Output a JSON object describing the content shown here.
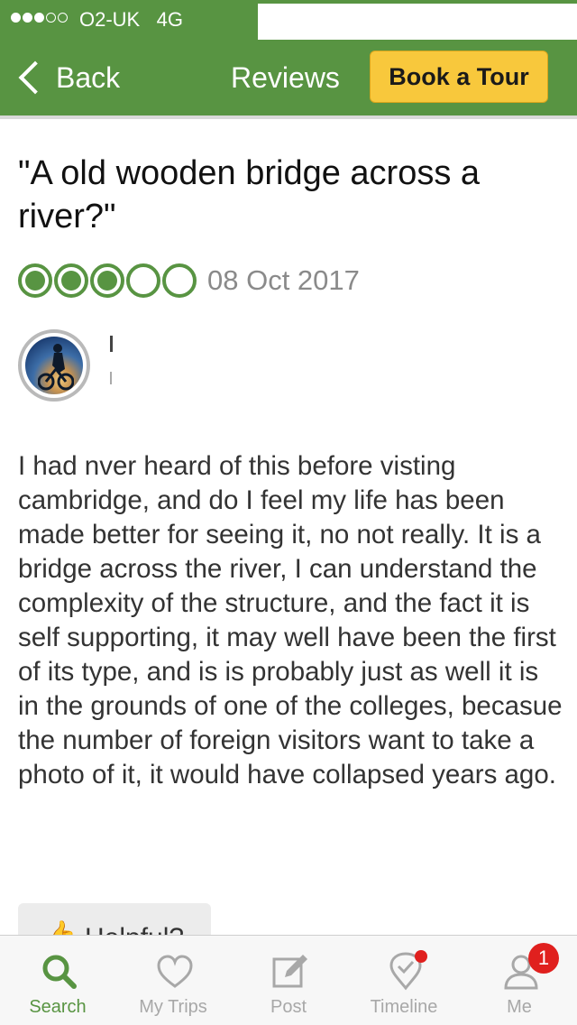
{
  "status_bar": {
    "carrier": "O2-UK",
    "network": "4G",
    "signal_bars_filled": 3,
    "signal_bars_total": 5
  },
  "nav": {
    "back_label": "Back",
    "title": "Reviews",
    "tour_button": "Book a Tour"
  },
  "review": {
    "title": "\"A old wooden bridge across  a river?\"",
    "rating": 3,
    "rating_max": 5,
    "date": "08 Oct 2017",
    "body": "I had nver heard of this before visting cambridge, and do I feel my life has been made better for seeing it, no not really. It is a bridge across the river, I can understand the complexity of the structure, and the fact it is self supporting, it may well have been the first of its type, and is is probably just as well it is in the grounds of one of the colleges, becasue the number of foreign visitors want to take a photo of it, it would have collapsed years ago.",
    "helpful_label": "Helpful?"
  },
  "tabs": [
    {
      "label": "Search",
      "icon": "search-icon",
      "active": true
    },
    {
      "label": "My Trips",
      "icon": "heart-icon",
      "active": false
    },
    {
      "label": "Post",
      "icon": "compose-icon",
      "active": false
    },
    {
      "label": "Timeline",
      "icon": "location-check-icon",
      "active": false
    },
    {
      "label": "Me",
      "icon": "person-icon",
      "active": false
    }
  ],
  "me_badge": "1",
  "colors": {
    "brand_green": "#589442",
    "button_yellow": "#f8c83c",
    "badge_red": "#e0201e"
  }
}
